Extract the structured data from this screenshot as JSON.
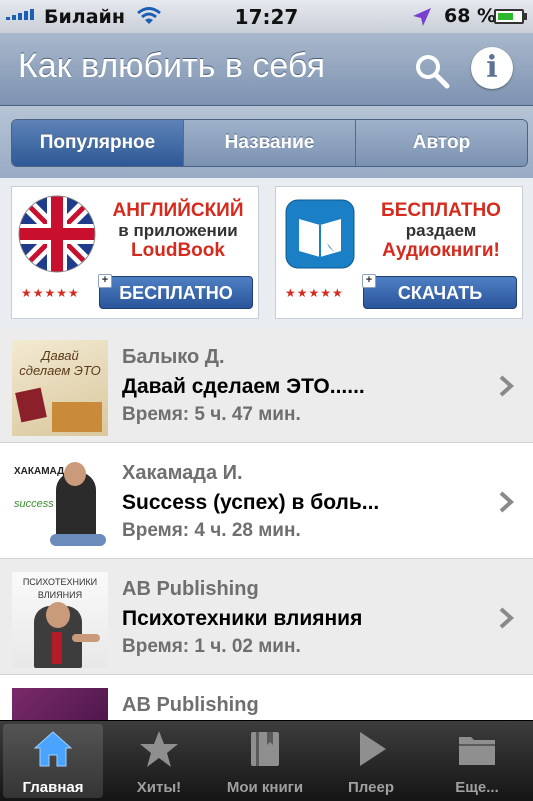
{
  "status_bar": {
    "carrier": "Билайн",
    "time": "17:27",
    "battery": "68 %",
    "battery_level": 0.68
  },
  "nav": {
    "title": "Как влюбить в себя",
    "search_icon": "search-icon",
    "info_icon": "info-icon",
    "info_glyph": "i"
  },
  "segments": [
    {
      "label": "Популярное",
      "active": true
    },
    {
      "label": "Название",
      "active": false
    },
    {
      "label": "Автор",
      "active": false
    }
  ],
  "banners": {
    "left": {
      "line1": "АНГЛИЙСКИЙ",
      "line2": "в приложении",
      "line3": "LoudBook",
      "stars": "★★★★★",
      "button": "БЕСПЛАТНО"
    },
    "right": {
      "line1": "БЕСПЛАТНО",
      "line2": "раздаем",
      "line3": "Аудиокниги!",
      "stars": "★★★★★",
      "button": "СКАЧАТЬ"
    }
  },
  "books": [
    {
      "author": "Балыко Д.",
      "title": "Давай сделаем ЭТО......",
      "time": "Время: 5 ч. 47 мин.",
      "cover_text": "Давай сделаем ЭТО"
    },
    {
      "author": "Хакамада И.",
      "title": "Success (успех) в боль...",
      "time": "Время: 4 ч. 28 мин.",
      "cover_text": "ХАКАМАДА"
    },
    {
      "author": "AB Publishing",
      "title": "Психотехники влияния",
      "time": "Время: 1 ч. 02 мин.",
      "cover_text": "ПСИХОТЕХНИКИ ВЛИЯНИЯ"
    },
    {
      "author": "AB Publishing",
      "title": "",
      "time": "",
      "cover_text": ""
    }
  ],
  "tabs": [
    {
      "label": "Главная",
      "icon": "home-icon",
      "active": true
    },
    {
      "label": "Хиты!",
      "icon": "star-icon",
      "active": false
    },
    {
      "label": "Мои книги",
      "icon": "book-icon",
      "active": false
    },
    {
      "label": "Плеер",
      "icon": "play-icon",
      "active": false
    },
    {
      "label": "Еще...",
      "icon": "more-icon",
      "active": false
    }
  ]
}
